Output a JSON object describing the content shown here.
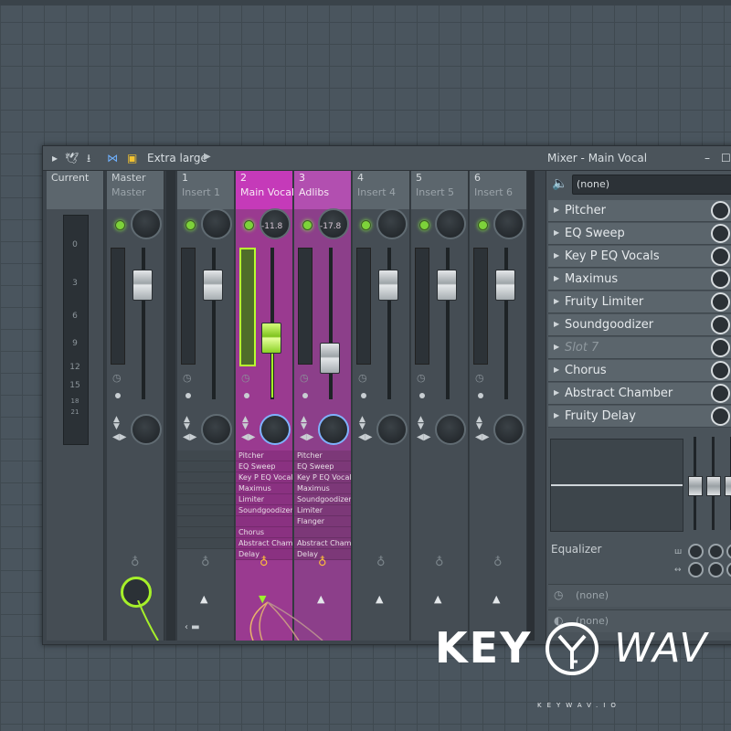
{
  "titlebar": {
    "preset": "Extra large",
    "title": "Mixer - Main Vocal",
    "minimize": "–",
    "maximize": "☐"
  },
  "current": {
    "label": "Current",
    "scale": [
      "0",
      "3",
      "6",
      "9",
      "12",
      "15",
      "18",
      "21"
    ]
  },
  "tracks": [
    {
      "number": "Master",
      "name": "Master"
    },
    {
      "number": "1",
      "name": "Insert 1"
    },
    {
      "number": "2",
      "name": "Main Vocal",
      "volume": "-11.8",
      "slots": [
        "Pitcher",
        "EQ Sweep",
        "Key P EQ Vocals",
        "Maximus",
        "Limiter",
        "Soundgoodizer",
        "",
        "Chorus",
        "Abstract Chamber",
        "Delay"
      ]
    },
    {
      "number": "3",
      "name": "Adlibs",
      "volume": "-17.8",
      "slots": [
        "Pitcher",
        "EQ Sweep",
        "Key P EQ Vocals",
        "Maximus",
        "Soundgoodizer",
        "Limiter",
        "Flanger",
        "",
        "Abstract Chamber",
        "Delay"
      ]
    },
    {
      "number": "4",
      "name": "Insert 4"
    },
    {
      "number": "5",
      "name": "Insert 5"
    },
    {
      "number": "6",
      "name": "Insert 6"
    }
  ],
  "panel": {
    "input": "(none)",
    "effects": [
      "Pitcher",
      "EQ Sweep",
      "Key P EQ Vocals",
      "Maximus",
      "Fruity Limiter",
      "Soundgoodizer",
      "Slot 7",
      "Chorus",
      "Abstract Chamber",
      "Fruity Delay"
    ],
    "equalizer_label": "Equalizer",
    "output1": "(none)",
    "output2": "(none)"
  },
  "logo": {
    "key": "KEY",
    "wav": "WAV",
    "small": "KEYWAV.IO"
  },
  "colors": {
    "selected_track": "#c53ab9",
    "second_track": "#b24fb0",
    "led_green": "#7dd23a",
    "fader_green": "#8bd225"
  }
}
